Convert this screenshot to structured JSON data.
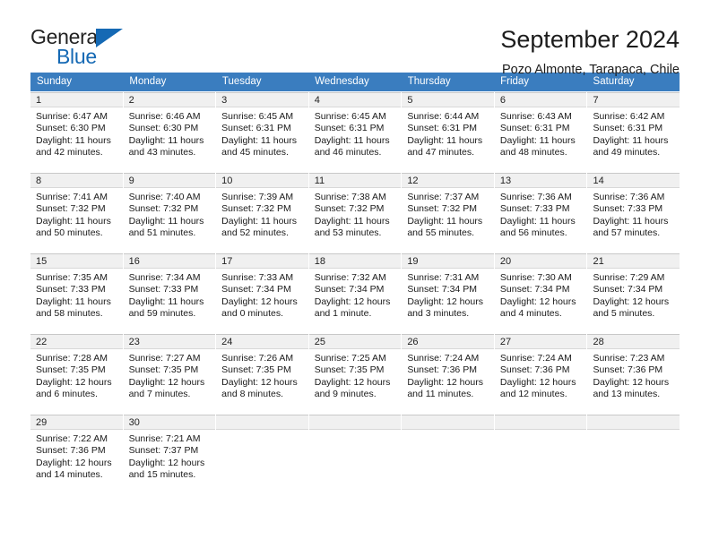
{
  "brand": {
    "name_part1": "General",
    "name_part2": "Blue",
    "accent_color": "#1569b4"
  },
  "header": {
    "title": "September 2024",
    "subtitle": "Pozo Almonte, Tarapaca, Chile"
  },
  "calendar": {
    "header_bg": "#3a7dbf",
    "weekdays": [
      "Sunday",
      "Monday",
      "Tuesday",
      "Wednesday",
      "Thursday",
      "Friday",
      "Saturday"
    ],
    "weeks": [
      [
        {
          "day": "1",
          "sunrise": "Sunrise: 6:47 AM",
          "sunset": "Sunset: 6:30 PM",
          "daylight_line1": "Daylight: 11 hours",
          "daylight_line2": "and 42 minutes."
        },
        {
          "day": "2",
          "sunrise": "Sunrise: 6:46 AM",
          "sunset": "Sunset: 6:30 PM",
          "daylight_line1": "Daylight: 11 hours",
          "daylight_line2": "and 43 minutes."
        },
        {
          "day": "3",
          "sunrise": "Sunrise: 6:45 AM",
          "sunset": "Sunset: 6:31 PM",
          "daylight_line1": "Daylight: 11 hours",
          "daylight_line2": "and 45 minutes."
        },
        {
          "day": "4",
          "sunrise": "Sunrise: 6:45 AM",
          "sunset": "Sunset: 6:31 PM",
          "daylight_line1": "Daylight: 11 hours",
          "daylight_line2": "and 46 minutes."
        },
        {
          "day": "5",
          "sunrise": "Sunrise: 6:44 AM",
          "sunset": "Sunset: 6:31 PM",
          "daylight_line1": "Daylight: 11 hours",
          "daylight_line2": "and 47 minutes."
        },
        {
          "day": "6",
          "sunrise": "Sunrise: 6:43 AM",
          "sunset": "Sunset: 6:31 PM",
          "daylight_line1": "Daylight: 11 hours",
          "daylight_line2": "and 48 minutes."
        },
        {
          "day": "7",
          "sunrise": "Sunrise: 6:42 AM",
          "sunset": "Sunset: 6:31 PM",
          "daylight_line1": "Daylight: 11 hours",
          "daylight_line2": "and 49 minutes."
        }
      ],
      [
        {
          "day": "8",
          "sunrise": "Sunrise: 7:41 AM",
          "sunset": "Sunset: 7:32 PM",
          "daylight_line1": "Daylight: 11 hours",
          "daylight_line2": "and 50 minutes."
        },
        {
          "day": "9",
          "sunrise": "Sunrise: 7:40 AM",
          "sunset": "Sunset: 7:32 PM",
          "daylight_line1": "Daylight: 11 hours",
          "daylight_line2": "and 51 minutes."
        },
        {
          "day": "10",
          "sunrise": "Sunrise: 7:39 AM",
          "sunset": "Sunset: 7:32 PM",
          "daylight_line1": "Daylight: 11 hours",
          "daylight_line2": "and 52 minutes."
        },
        {
          "day": "11",
          "sunrise": "Sunrise: 7:38 AM",
          "sunset": "Sunset: 7:32 PM",
          "daylight_line1": "Daylight: 11 hours",
          "daylight_line2": "and 53 minutes."
        },
        {
          "day": "12",
          "sunrise": "Sunrise: 7:37 AM",
          "sunset": "Sunset: 7:32 PM",
          "daylight_line1": "Daylight: 11 hours",
          "daylight_line2": "and 55 minutes."
        },
        {
          "day": "13",
          "sunrise": "Sunrise: 7:36 AM",
          "sunset": "Sunset: 7:33 PM",
          "daylight_line1": "Daylight: 11 hours",
          "daylight_line2": "and 56 minutes."
        },
        {
          "day": "14",
          "sunrise": "Sunrise: 7:36 AM",
          "sunset": "Sunset: 7:33 PM",
          "daylight_line1": "Daylight: 11 hours",
          "daylight_line2": "and 57 minutes."
        }
      ],
      [
        {
          "day": "15",
          "sunrise": "Sunrise: 7:35 AM",
          "sunset": "Sunset: 7:33 PM",
          "daylight_line1": "Daylight: 11 hours",
          "daylight_line2": "and 58 minutes."
        },
        {
          "day": "16",
          "sunrise": "Sunrise: 7:34 AM",
          "sunset": "Sunset: 7:33 PM",
          "daylight_line1": "Daylight: 11 hours",
          "daylight_line2": "and 59 minutes."
        },
        {
          "day": "17",
          "sunrise": "Sunrise: 7:33 AM",
          "sunset": "Sunset: 7:34 PM",
          "daylight_line1": "Daylight: 12 hours",
          "daylight_line2": "and 0 minutes."
        },
        {
          "day": "18",
          "sunrise": "Sunrise: 7:32 AM",
          "sunset": "Sunset: 7:34 PM",
          "daylight_line1": "Daylight: 12 hours",
          "daylight_line2": "and 1 minute."
        },
        {
          "day": "19",
          "sunrise": "Sunrise: 7:31 AM",
          "sunset": "Sunset: 7:34 PM",
          "daylight_line1": "Daylight: 12 hours",
          "daylight_line2": "and 3 minutes."
        },
        {
          "day": "20",
          "sunrise": "Sunrise: 7:30 AM",
          "sunset": "Sunset: 7:34 PM",
          "daylight_line1": "Daylight: 12 hours",
          "daylight_line2": "and 4 minutes."
        },
        {
          "day": "21",
          "sunrise": "Sunrise: 7:29 AM",
          "sunset": "Sunset: 7:34 PM",
          "daylight_line1": "Daylight: 12 hours",
          "daylight_line2": "and 5 minutes."
        }
      ],
      [
        {
          "day": "22",
          "sunrise": "Sunrise: 7:28 AM",
          "sunset": "Sunset: 7:35 PM",
          "daylight_line1": "Daylight: 12 hours",
          "daylight_line2": "and 6 minutes."
        },
        {
          "day": "23",
          "sunrise": "Sunrise: 7:27 AM",
          "sunset": "Sunset: 7:35 PM",
          "daylight_line1": "Daylight: 12 hours",
          "daylight_line2": "and 7 minutes."
        },
        {
          "day": "24",
          "sunrise": "Sunrise: 7:26 AM",
          "sunset": "Sunset: 7:35 PM",
          "daylight_line1": "Daylight: 12 hours",
          "daylight_line2": "and 8 minutes."
        },
        {
          "day": "25",
          "sunrise": "Sunrise: 7:25 AM",
          "sunset": "Sunset: 7:35 PM",
          "daylight_line1": "Daylight: 12 hours",
          "daylight_line2": "and 9 minutes."
        },
        {
          "day": "26",
          "sunrise": "Sunrise: 7:24 AM",
          "sunset": "Sunset: 7:36 PM",
          "daylight_line1": "Daylight: 12 hours",
          "daylight_line2": "and 11 minutes."
        },
        {
          "day": "27",
          "sunrise": "Sunrise: 7:24 AM",
          "sunset": "Sunset: 7:36 PM",
          "daylight_line1": "Daylight: 12 hours",
          "daylight_line2": "and 12 minutes."
        },
        {
          "day": "28",
          "sunrise": "Sunrise: 7:23 AM",
          "sunset": "Sunset: 7:36 PM",
          "daylight_line1": "Daylight: 12 hours",
          "daylight_line2": "and 13 minutes."
        }
      ],
      [
        {
          "day": "29",
          "sunrise": "Sunrise: 7:22 AM",
          "sunset": "Sunset: 7:36 PM",
          "daylight_line1": "Daylight: 12 hours",
          "daylight_line2": "and 14 minutes."
        },
        {
          "day": "30",
          "sunrise": "Sunrise: 7:21 AM",
          "sunset": "Sunset: 7:37 PM",
          "daylight_line1": "Daylight: 12 hours",
          "daylight_line2": "and 15 minutes."
        },
        {
          "day": "",
          "sunrise": "",
          "sunset": "",
          "daylight_line1": "",
          "daylight_line2": ""
        },
        {
          "day": "",
          "sunrise": "",
          "sunset": "",
          "daylight_line1": "",
          "daylight_line2": ""
        },
        {
          "day": "",
          "sunrise": "",
          "sunset": "",
          "daylight_line1": "",
          "daylight_line2": ""
        },
        {
          "day": "",
          "sunrise": "",
          "sunset": "",
          "daylight_line1": "",
          "daylight_line2": ""
        },
        {
          "day": "",
          "sunrise": "",
          "sunset": "",
          "daylight_line1": "",
          "daylight_line2": ""
        }
      ]
    ]
  }
}
